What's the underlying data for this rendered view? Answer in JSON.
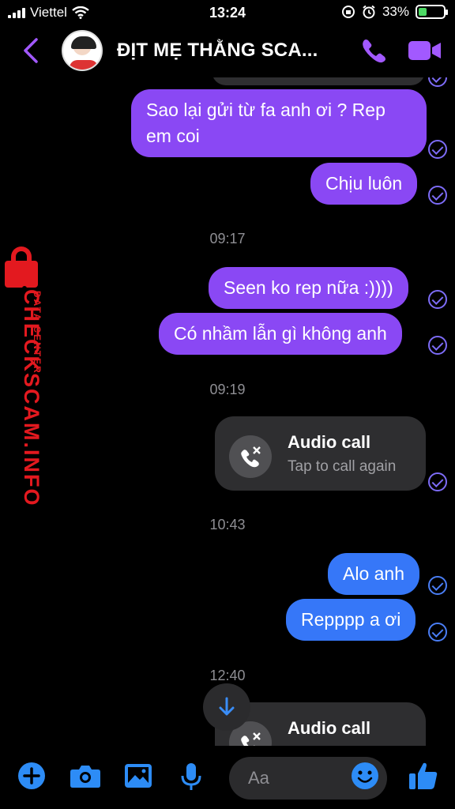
{
  "status_bar": {
    "carrier": "Viettel",
    "time": "13:24",
    "battery": "33%",
    "battery_level": 0.33
  },
  "header": {
    "title": "ĐỊT MẸ THẰNG SCA..."
  },
  "messages": [
    {
      "text_line1": "Sao lại gửi từ fa anh ơi ? Rep",
      "text_line2": "em coi"
    },
    {
      "text": "Chịu luôn"
    },
    {
      "text": "Seen ko rep nữa :))))"
    },
    {
      "text": "Có nhầm lẫn gì không anh"
    },
    {
      "text": "Alo anh"
    },
    {
      "text": "Repppp a ơi"
    }
  ],
  "timestamps": [
    "09:17",
    "09:19",
    "10:43",
    "12:40"
  ],
  "calls": [
    {
      "title": "Audio call",
      "subtitle": "Tap to call again"
    },
    {
      "title": "Audio call"
    }
  ],
  "watermark": {
    "brand": "CHECKSCAM.INFO",
    "sub": "DATA CENTER"
  },
  "composer": {
    "placeholder": "Aa"
  },
  "colors": {
    "purple": "#8a48f4",
    "blue": "#3677f8",
    "accent": "#a259ff"
  },
  "icons": [
    "back-chevron-icon",
    "phone-icon",
    "video-icon",
    "plus-icon",
    "camera-icon",
    "image-icon",
    "mic-icon",
    "emoji-icon",
    "thumbs-up-icon",
    "missed-call-icon",
    "arrow-down-icon",
    "check-circle-icon"
  ]
}
